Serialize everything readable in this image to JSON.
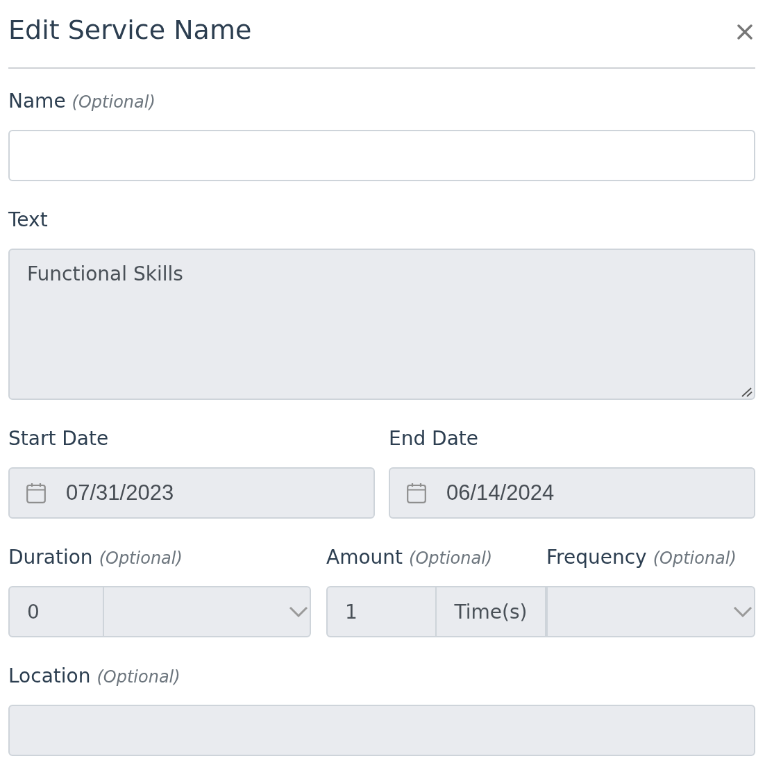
{
  "dialog": {
    "title": "Edit Service Name"
  },
  "rows": [
    {
      "fields": [
        {
          "kind": "text",
          "label": "Name",
          "note": "(Optional)",
          "disabled": false
        }
      ]
    },
    {
      "fields": [
        {
          "kind": "textarea",
          "label": "Text",
          "value": "Functional Skills",
          "disabled": true
        }
      ]
    },
    {
      "fields": [
        {
          "kind": "date",
          "label": "Start Date",
          "value": "07/31/2023",
          "disabled": true
        },
        {
          "kind": "date",
          "label": "End Date",
          "value": "06/14/2024",
          "disabled": true
        }
      ]
    },
    {
      "fields": [
        {
          "kind": "number-select",
          "label": "Duration",
          "note": "(Optional)",
          "value": "0",
          "disabled": true
        },
        {
          "kind": "number-unit",
          "label": "Amount",
          "note": "(Optional)",
          "value": "1",
          "unit": "Time(s)",
          "disabled": true
        },
        {
          "kind": "select",
          "label": "Frequency",
          "note": "(Optional)",
          "disabled": true
        }
      ]
    },
    {
      "fields": [
        {
          "kind": "text",
          "label": "Location",
          "note": "(Optional)",
          "disabled": true
        }
      ]
    }
  ]
}
